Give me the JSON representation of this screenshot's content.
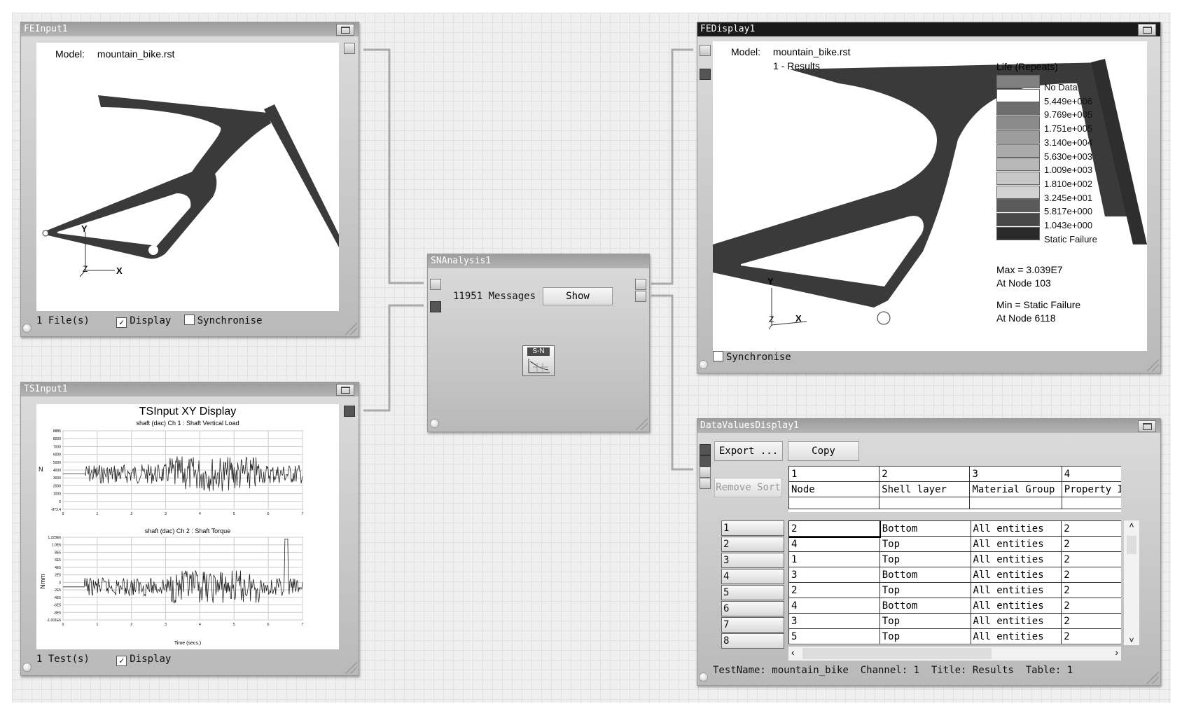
{
  "fbinput": {
    "title": "FEInput1",
    "model_label": "Model:",
    "model_value": "mountain_bike.rst",
    "files": "1 File(s)",
    "display_label": "Display",
    "display_checked": true,
    "sync_label": "Synchronise",
    "sync_checked": false,
    "axis_y": "Y",
    "axis_x": "X",
    "axis_z": "Z"
  },
  "fedisplay": {
    "title": "FEDisplay1",
    "model_label": "Model:",
    "model_value": "mountain_bike.rst",
    "results": "1 - Results",
    "legend_title": "Life (Repeats)",
    "legend": [
      {
        "label": "No Data",
        "color": "#808080"
      },
      {
        "label": "5.449e+006",
        "color": "#ffffff"
      },
      {
        "label": "9.769e+005",
        "color": "#6e6e6e"
      },
      {
        "label": "1.751e+005",
        "color": "#8a8a8a"
      },
      {
        "label": "3.140e+004",
        "color": "#9c9c9c"
      },
      {
        "label": "5.630e+003",
        "color": "#aaaaaa"
      },
      {
        "label": "1.009e+003",
        "color": "#b8b8b8"
      },
      {
        "label": "1.810e+002",
        "color": "#c6c6c6"
      },
      {
        "label": "3.245e+001",
        "color": "#d2d2d2"
      },
      {
        "label": "5.817e+000",
        "color": "#5a5a5a"
      },
      {
        "label": "1.043e+000",
        "color": "#484848"
      },
      {
        "label": "Static Failure",
        "color": "#2a2a2a"
      }
    ],
    "max_line": "Max = 3.039E7",
    "max_node": "At Node 103",
    "min_line": "Min = Static Failure",
    "min_node": "At Node 6118",
    "sync_label": "Synchronise",
    "axis_y": "Y",
    "axis_x": "X",
    "axis_z": "Z"
  },
  "snanalysis": {
    "title": "SNAnalysis1",
    "messages": "11951 Messages",
    "show_label": "Show",
    "icon_text": "S-N"
  },
  "tsinput": {
    "title": "TSInput1",
    "chart_title": "TSInput XY Display",
    "ch1_title": "shaft (dac)  Ch 1 : Shaft Vertical Load",
    "ch1_ylabel": "N",
    "ch1_yticks": [
      "8885",
      "8000",
      "7000",
      "6000",
      "5000",
      "4000",
      "3000",
      "2000",
      "1000",
      "0",
      "-873.4"
    ],
    "ch2_title": "shaft (dac)  Ch 2 : Shaft Torque",
    "ch2_ylabel": "Nmm",
    "ch2_yticks": [
      "1.223E6",
      "1.0E6",
      "8E5",
      "6E5",
      "4E5",
      "2E5",
      "0",
      "-2E5",
      "-4E5",
      "-6E5",
      "-8E5",
      "-1.001E6"
    ],
    "xticks": [
      "0",
      "1",
      "2",
      "3",
      "4",
      "5",
      "6",
      "7"
    ],
    "xlabel": "Time (secs.)",
    "tests": "1 Test(s)",
    "display_label": "Display",
    "display_checked": true
  },
  "datavalues": {
    "title": "DataValuesDisplay1",
    "export_label": "Export ...",
    "copy_label": "Copy",
    "remove_sort_label": "Remove Sort",
    "col_numbers": [
      "1",
      "2",
      "3",
      "4"
    ],
    "col_headers": [
      "Node",
      "Shell layer",
      "Material Group",
      "Property ID"
    ],
    "rows": [
      {
        "n": "1",
        "cells": [
          "2",
          "Bottom",
          "All entities",
          "2"
        ]
      },
      {
        "n": "2",
        "cells": [
          "4",
          "Top",
          "All entities",
          "2"
        ]
      },
      {
        "n": "3",
        "cells": [
          "1",
          "Top",
          "All entities",
          "2"
        ]
      },
      {
        "n": "4",
        "cells": [
          "3",
          "Bottom",
          "All entities",
          "2"
        ]
      },
      {
        "n": "5",
        "cells": [
          "2",
          "Top",
          "All entities",
          "2"
        ]
      },
      {
        "n": "6",
        "cells": [
          "4",
          "Bottom",
          "All entities",
          "2"
        ]
      },
      {
        "n": "7",
        "cells": [
          "3",
          "Top",
          "All entities",
          "2"
        ]
      },
      {
        "n": "8",
        "cells": [
          "5",
          "Top",
          "All entities",
          "2"
        ]
      }
    ],
    "status": "TestName: mountain_bike  Channel: 1  Title: Results  Table: 1"
  }
}
